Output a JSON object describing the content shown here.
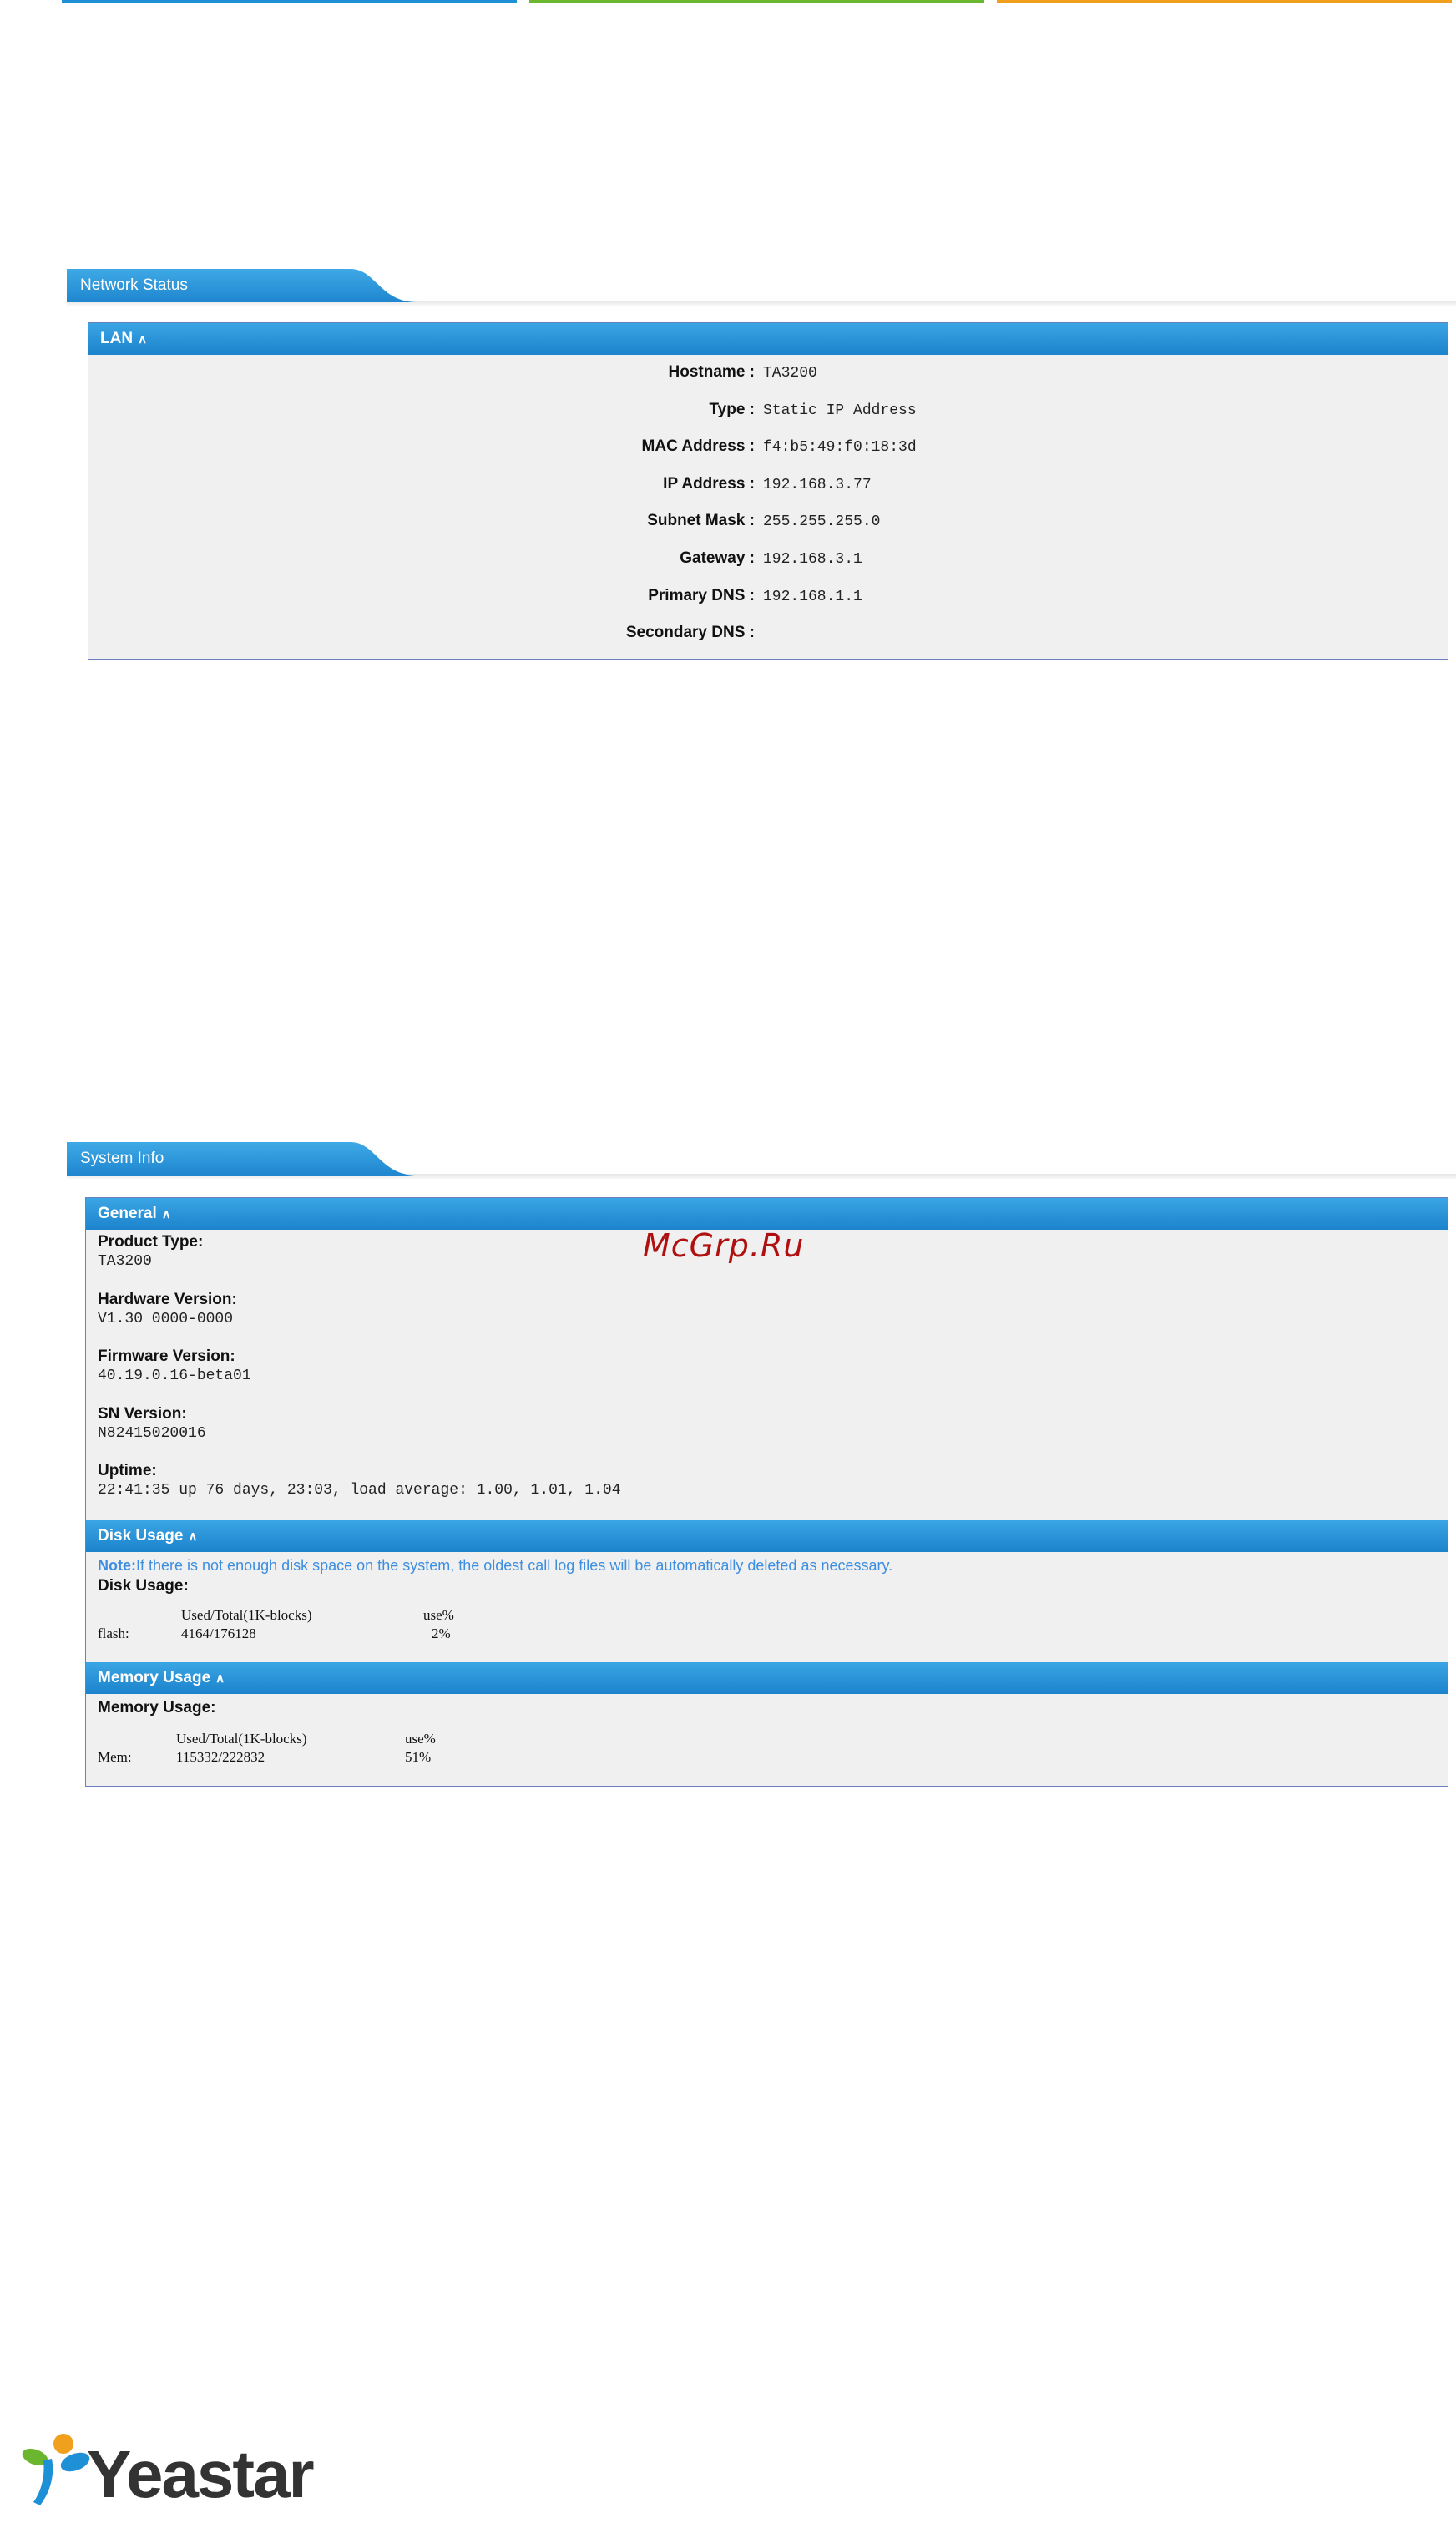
{
  "theme": {
    "stripe_colors": [
      "#1e90d6",
      "#6ab62e",
      "#f0a01c"
    ],
    "accent_blue": "#1f86cf",
    "note_blue": "#3d8ee0",
    "watermark_red": "#b01010"
  },
  "network_status": {
    "title": "Network Status",
    "lan": {
      "label": "LAN",
      "rows": [
        {
          "label": "Hostname :",
          "value": "TA3200"
        },
        {
          "label": "Type :",
          "value": "Static IP Address"
        },
        {
          "label": "MAC Address :",
          "value": "f4:b5:49:f0:18:3d"
        },
        {
          "label": "IP Address :",
          "value": "192.168.3.77"
        },
        {
          "label": "Subnet Mask :",
          "value": "255.255.255.0"
        },
        {
          "label": "Gateway :",
          "value": "192.168.3.1"
        },
        {
          "label": "Primary DNS :",
          "value": "192.168.1.1"
        },
        {
          "label": "Secondary DNS :",
          "value": ""
        }
      ]
    }
  },
  "system_info": {
    "title": "System Info",
    "general": {
      "label": "General",
      "items": [
        {
          "label": "Product Type:",
          "value": "TA3200"
        },
        {
          "label": "Hardware Version:",
          "value": "V1.30 0000-0000"
        },
        {
          "label": "Firmware Version:",
          "value": "40.19.0.16-beta01"
        },
        {
          "label": "SN Version:",
          "value": "N82415020016"
        },
        {
          "label": "Uptime:",
          "value": "22:41:35 up 76 days, 23:03, load average: 1.00, 1.01, 1.04"
        }
      ]
    },
    "disk_usage": {
      "label": "Disk Usage",
      "note_prefix": "Note:",
      "note_text": "If there is not enough disk space on the system, the oldest call log files will be automatically deleted as necessary.",
      "sub_label": "Disk Usage:",
      "header_used": "Used/Total(1K-blocks)",
      "header_pct": "use%",
      "row_name": "flash:",
      "row_used": "4164/176128",
      "row_pct": "2%"
    },
    "memory_usage": {
      "label": "Memory Usage",
      "sub_label": "Memory Usage:",
      "header_used": "Used/Total(1K-blocks)",
      "header_pct": "use%",
      "row_name": "Mem:",
      "row_used": "115332/222832",
      "row_pct": "51%"
    }
  },
  "watermark": "McGrp.Ru",
  "logo_text": "Yeastar"
}
